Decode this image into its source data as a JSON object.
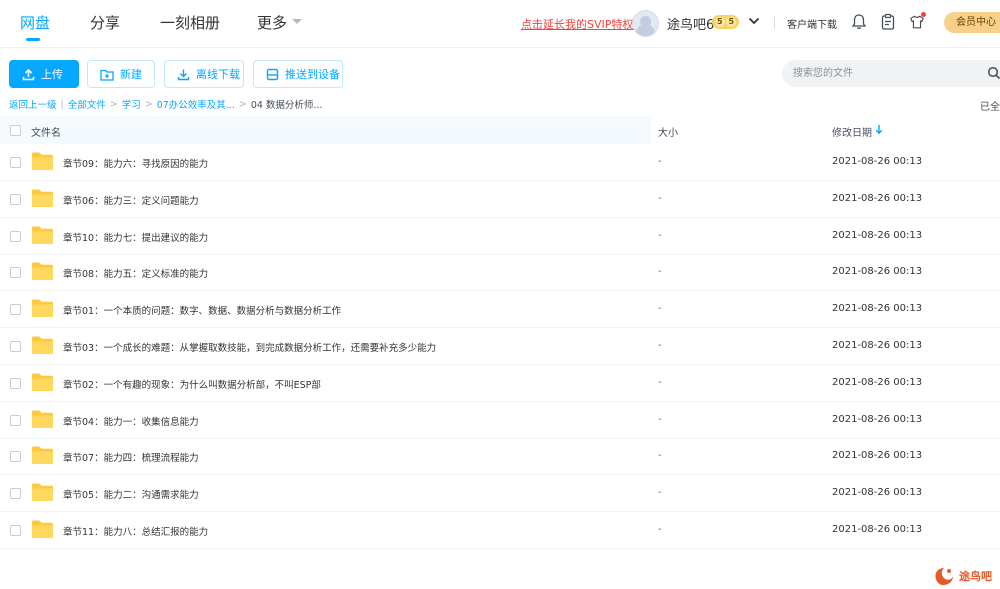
{
  "nav": {
    "tabs": [
      {
        "label": "网盘",
        "active": true
      },
      {
        "label": "分享",
        "active": false
      },
      {
        "label": "一刻相册",
        "active": false
      },
      {
        "label": "更多",
        "active": false
      }
    ],
    "svip_link": "点击延长我的SVIP特权",
    "username": "途鸟吧6",
    "level_badge": [
      "5",
      "5"
    ],
    "client_download": "客户端下载",
    "member_center": "会员中心"
  },
  "toolbar": {
    "upload": "上传",
    "new_folder": "新建",
    "offline_download": "离线下载",
    "push_to_device": "推送到设备",
    "search_placeholder": "搜索您的文件"
  },
  "breadcrumb": {
    "items": [
      "返回上一级",
      "全部文件",
      "学习",
      "07办公效率及其...",
      "04 数据分析师..."
    ],
    "loaded_status": "已全"
  },
  "table": {
    "headers": {
      "name": "文件名",
      "size": "大小",
      "modified": "修改日期"
    },
    "sort_column": "modified",
    "sort_direction": "desc",
    "rows": [
      {
        "name": "章节09：能力六：寻找原因的能力",
        "size": "-",
        "date": "2021-08-26 00:13"
      },
      {
        "name": "章节06：能力三：定义问题能力",
        "size": "-",
        "date": "2021-08-26 00:13"
      },
      {
        "name": "章节10：能力七：提出建议的能力",
        "size": "-",
        "date": "2021-08-26 00:13"
      },
      {
        "name": "章节08：能力五：定义标准的能力",
        "size": "-",
        "date": "2021-08-26 00:13"
      },
      {
        "name": "章节01：一个本质的问题：数字、数据、数据分析与数据分析工作",
        "size": "-",
        "date": "2021-08-26 00:13"
      },
      {
        "name": "章节03：一个成长的难题：从掌握取数技能，到完成数据分析工作，还需要补充多少能力",
        "size": "-",
        "date": "2021-08-26 00:13"
      },
      {
        "name": "章节02：一个有趣的现象：为什么叫数据分析部，不叫ESP部",
        "size": "-",
        "date": "2021-08-26 00:13"
      },
      {
        "name": "章节04：能力一：收集信息能力",
        "size": "-",
        "date": "2021-08-26 00:13"
      },
      {
        "name": "章节07：能力四：梳理流程能力",
        "size": "-",
        "date": "2021-08-26 00:13"
      },
      {
        "name": "章节05：能力二：沟通需求能力",
        "size": "-",
        "date": "2021-08-26 00:13"
      },
      {
        "name": "章节11：能力八：总结汇报的能力",
        "size": "-",
        "date": "2021-08-26 00:13"
      }
    ]
  },
  "watermark": {
    "text": "途鸟吧"
  },
  "colors": {
    "accent": "#06a7ff",
    "svip_red": "#f2403b",
    "folder_yellow": "#ffc93f",
    "member_gold": "#f7d08a"
  }
}
